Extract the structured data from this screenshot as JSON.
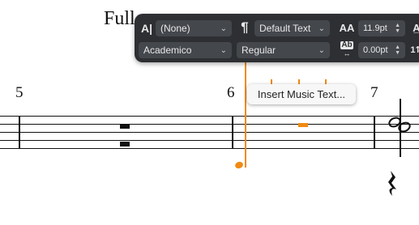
{
  "score": {
    "title": "Full",
    "bar_numbers": [
      "5",
      "6",
      "7"
    ]
  },
  "properties_panel": {
    "row1": {
      "paragraph_style_icon": "A|",
      "paragraph_style_value": "(None)",
      "character_style_value": "Default Text",
      "font_size_icon": "AA",
      "font_size_value": "11.9pt"
    },
    "row2": {
      "font_family_value": "Academico",
      "font_style_value": "Regular",
      "tracking_icon": "Ab",
      "tracking_value": "0.00pt"
    }
  },
  "context_menu": {
    "item": "Insert Music Text..."
  },
  "colors": {
    "panel_bg": "#2d2f33",
    "accent_orange": "#f08a12"
  }
}
